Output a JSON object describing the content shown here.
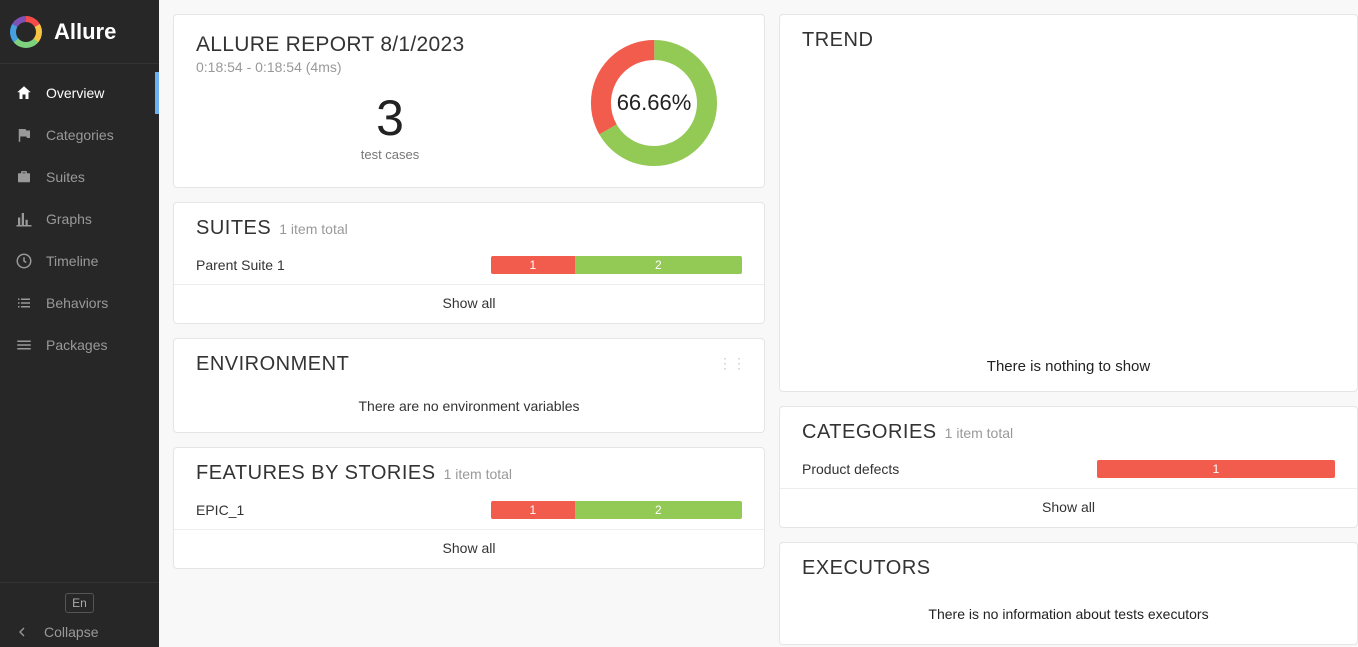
{
  "brand": {
    "name": "Allure"
  },
  "nav": {
    "items": [
      {
        "label": "Overview"
      },
      {
        "label": "Categories"
      },
      {
        "label": "Suites"
      },
      {
        "label": "Graphs"
      },
      {
        "label": "Timeline"
      },
      {
        "label": "Behaviors"
      },
      {
        "label": "Packages"
      }
    ],
    "lang": "En",
    "collapse": "Collapse"
  },
  "summary": {
    "title": "ALLURE REPORT 8/1/2023",
    "subtitle": "0:18:54 - 0:18:54 (4ms)",
    "test_cases_count": "3",
    "test_cases_label": "test cases",
    "percent": "66.66%",
    "donut": {
      "failed": 1,
      "passed": 2,
      "total": 3
    }
  },
  "suites": {
    "title": "SUITES",
    "count_label": "1 item total",
    "items": [
      {
        "name": "Parent Suite 1",
        "failed": 1,
        "passed": 2,
        "failed_label": "1",
        "passed_label": "2"
      }
    ],
    "show_all": "Show all"
  },
  "environment": {
    "title": "ENVIRONMENT",
    "empty": "There are no environment variables"
  },
  "features": {
    "title": "FEATURES BY STORIES",
    "count_label": "1 item total",
    "items": [
      {
        "name": "EPIC_1",
        "failed": 1,
        "passed": 2,
        "failed_label": "1",
        "passed_label": "2"
      }
    ],
    "show_all": "Show all"
  },
  "trend": {
    "title": "TREND",
    "empty": "There is nothing to show"
  },
  "categories": {
    "title": "CATEGORIES",
    "count_label": "1 item total",
    "items": [
      {
        "name": "Product defects",
        "count": 1,
        "count_label": "1"
      }
    ],
    "show_all": "Show all"
  },
  "executors": {
    "title": "EXECUTORS",
    "empty": "There is no information about tests executors"
  },
  "chart_data": {
    "type": "pie",
    "title": "Test pass rate",
    "categories": [
      "failed",
      "passed"
    ],
    "values": [
      1,
      2
    ],
    "percent": 66.66
  }
}
